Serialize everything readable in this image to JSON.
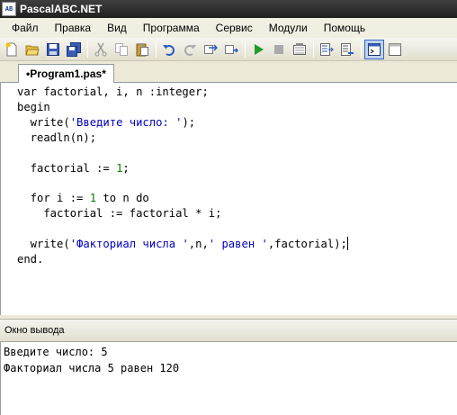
{
  "window": {
    "title": "PascalABC.NET",
    "icon_text": "AB\nabc"
  },
  "menu": [
    "Файл",
    "Правка",
    "Вид",
    "Программа",
    "Сервис",
    "Модули",
    "Помощь"
  ],
  "toolbar": {
    "icons": [
      "new-file-icon",
      "open-icon",
      "save-icon",
      "save-all-icon",
      "cut-icon",
      "copy-icon",
      "paste-icon",
      "undo-icon",
      "redo-icon",
      "find-icon",
      "replace-icon",
      "run-icon",
      "stop-icon",
      "compile-icon",
      "debug-step-icon",
      "debug-step-over-icon",
      "output-window-icon",
      "properties-icon"
    ]
  },
  "tab": {
    "label": "•Program1.pas*"
  },
  "editor": {
    "lines": [
      "var factorial, i, n :integer;",
      "begin",
      "  write('Введите число: ');",
      "  readln(n);",
      "",
      "  factorial := 1;",
      "",
      "  for i := 1 to n do",
      "    factorial := factorial * i;",
      "",
      "  write('Факториал числа ',n,' равен ',factorial);",
      "end."
    ]
  },
  "output_panel": {
    "title": "Окно вывода",
    "lines": [
      "Введите число: 5",
      "Факториал числа 5 равен 120"
    ]
  },
  "colors": {
    "string": "#0000c0",
    "number": "#008000",
    "titlebar": "#2b2b2b"
  }
}
